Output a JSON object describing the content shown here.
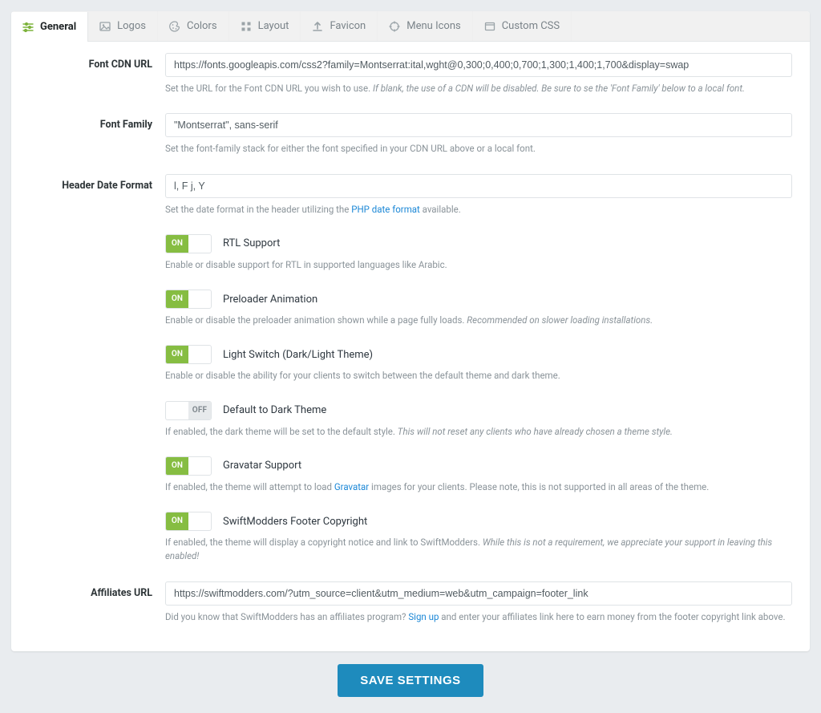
{
  "tabs": {
    "general": "General",
    "logos": "Logos",
    "colors": "Colors",
    "layout": "Layout",
    "favicon": "Favicon",
    "menu_icons": "Menu Icons",
    "custom_css": "Custom CSS"
  },
  "fields": {
    "font_cdn": {
      "label": "Font CDN URL",
      "value": "https://fonts.googleapis.com/css2?family=Montserrat:ital,wght@0,300;0,400;0,700;1,300;1,400;1,700&display=swap",
      "help_prefix": "Set the URL for the Font CDN URL you wish to use. ",
      "help_em": "If blank, the use of a CDN will be disabled. Be sure to se the 'Font Family' below to a local font."
    },
    "font_family": {
      "label": "Font Family",
      "value": "\"Montserrat\", sans-serif",
      "help": "Set the font-family stack for either the font specified in your CDN URL above or a local font."
    },
    "date_format": {
      "label": "Header Date Format",
      "value": "l, F j, Y",
      "help_prefix": "Set the date format in the header utilizing the ",
      "help_link": "PHP date format",
      "help_suffix": " available."
    },
    "rtl": {
      "label": "RTL Support",
      "state": "on",
      "help": "Enable or disable support for RTL in supported languages like Arabic."
    },
    "preloader": {
      "label": "Preloader Animation",
      "state": "on",
      "help_prefix": "Enable or disable the preloader animation shown while a page fully loads. ",
      "help_em": "Recommended on slower loading installations."
    },
    "light_switch": {
      "label": "Light Switch (Dark/Light Theme)",
      "state": "on",
      "help": "Enable or disable the ability for your clients to switch between the default theme and dark theme."
    },
    "default_dark": {
      "label": "Default to Dark Theme",
      "state": "off",
      "help_prefix": "If enabled, the dark theme will be set to the default style. ",
      "help_em": "This will not reset any clients who have already chosen a theme style."
    },
    "gravatar": {
      "label": "Gravatar Support",
      "state": "on",
      "help_prefix": "If enabled, the theme will attempt to load ",
      "help_link": "Gravatar",
      "help_suffix": " images for your clients. Please note, this is not supported in all areas of the theme."
    },
    "footer_copy": {
      "label": "SwiftModders Footer Copyright",
      "state": "on",
      "help_prefix": "If enabled, the theme will display a copyright notice and link to SwiftModders. ",
      "help_em": "While this is not a requirement, we appreciate your support in leaving this enabled!"
    },
    "affiliates": {
      "label": "Affiliates URL",
      "value": "https://swiftmodders.com/?utm_source=client&utm_medium=web&utm_campaign=footer_link",
      "help_prefix": "Did you know that SwiftModders has an affiliates program? ",
      "help_link": "Sign up",
      "help_suffix": " and enter your affiliates link here to earn money from the footer copyright link above."
    }
  },
  "toggle_text": {
    "on": "ON",
    "off": "OFF"
  },
  "save_button": "SAVE SETTINGS"
}
